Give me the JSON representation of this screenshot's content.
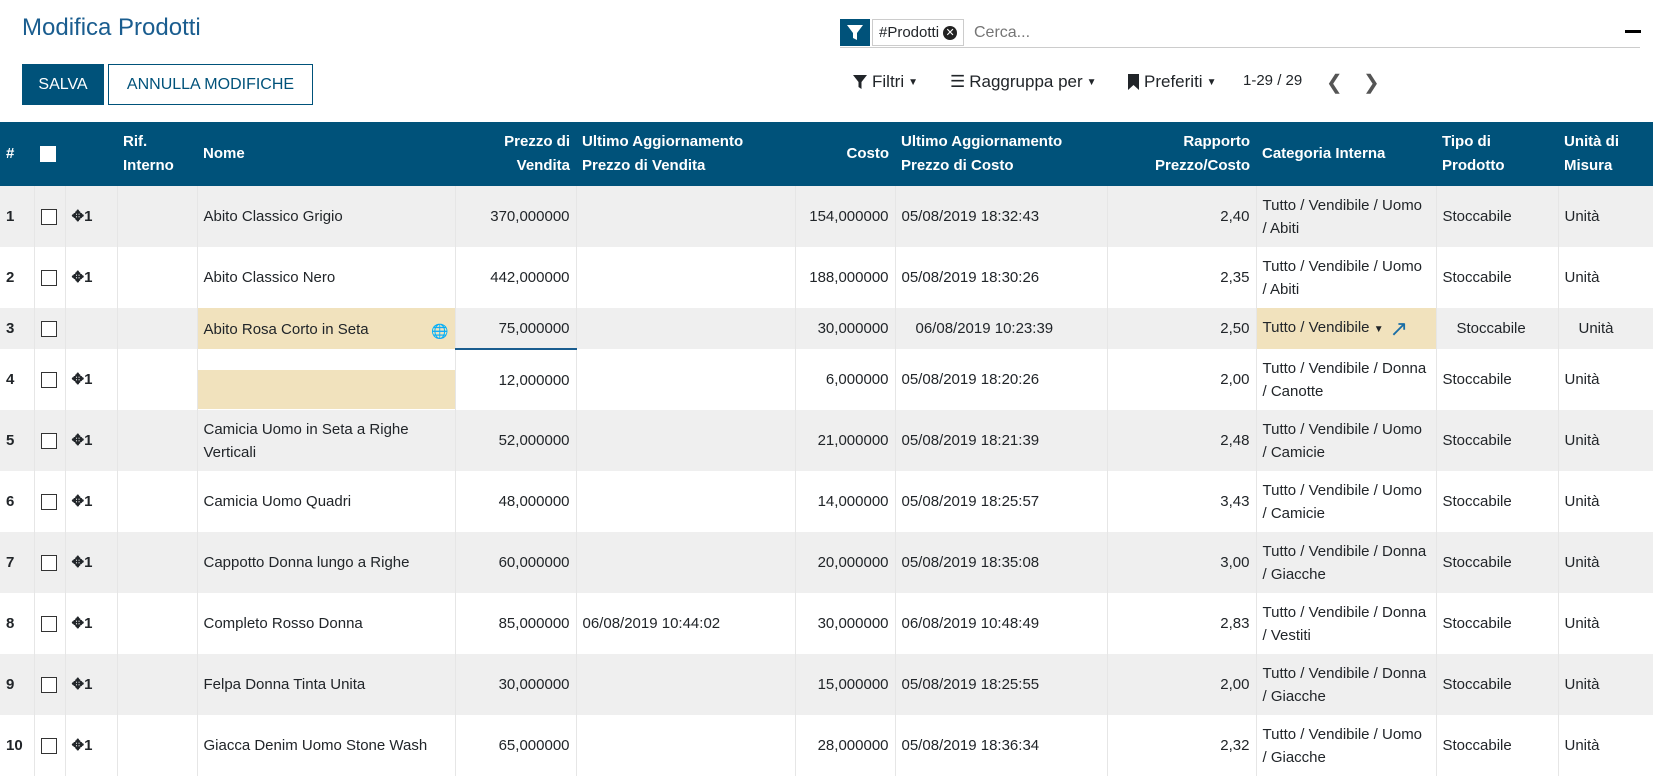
{
  "page": {
    "title": "Modifica Prodotti"
  },
  "buttons": {
    "save": "SALVA",
    "cancel": "ANNULLA MODIFICHE"
  },
  "search": {
    "facet": "#Prodotti",
    "placeholder": "Cerca..."
  },
  "controls": {
    "filters": "Filtri",
    "group_by": "Raggruppa per",
    "favorites": "Preferiti",
    "pager": "1-29 / 29"
  },
  "columns": {
    "num": "#",
    "ref": "Rif. Interno",
    "name": "Nome",
    "sale_price": "Prezzo di Vendita",
    "sale_update": "Ultimo Aggiornamento Prezzo di Vendita",
    "cost": "Costo",
    "cost_update": "Ultimo Aggiornamento Prezzo di Costo",
    "ratio": "Rapporto Prezzo/Costo",
    "category": "Categoria Interna",
    "type": "Tipo di Prodotto",
    "uom": "Unità di Misura"
  },
  "rows": [
    {
      "n": "1",
      "seq": "1",
      "name": "Abito Classico Grigio",
      "price": "370,000000",
      "sale_update": "",
      "cost": "154,000000",
      "cost_update": "05/08/2019 18:32:43",
      "ratio": "2,40",
      "category": "Tutto / Vendibile / Uomo / Abiti",
      "type": "Stoccabile",
      "uom": "Unità"
    },
    {
      "n": "2",
      "seq": "1",
      "name": "Abito Classico Nero",
      "price": "442,000000",
      "sale_update": "",
      "cost": "188,000000",
      "cost_update": "05/08/2019 18:30:26",
      "ratio": "2,35",
      "category": "Tutto / Vendibile / Uomo / Abiti",
      "type": "Stoccabile",
      "uom": "Unità"
    },
    {
      "n": "3",
      "seq": "",
      "name": "Abito Rosa Corto in Seta",
      "price": "75,000000",
      "sale_update": "",
      "cost": "30,000000",
      "cost_update": "06/08/2019 10:23:39",
      "ratio": "2,50",
      "category": "Tutto / Vendibile",
      "type": "Stoccabile",
      "uom": "Unità"
    },
    {
      "n": "4",
      "seq": "1",
      "name": "",
      "price": "12,000000",
      "sale_update": "",
      "cost": "6,000000",
      "cost_update": "05/08/2019 18:20:26",
      "ratio": "2,00",
      "category": "Tutto / Vendibile / Donna / Canotte",
      "type": "Stoccabile",
      "uom": "Unità"
    },
    {
      "n": "5",
      "seq": "1",
      "name": "Camicia Uomo in Seta a Righe Verticali",
      "price": "52,000000",
      "sale_update": "",
      "cost": "21,000000",
      "cost_update": "05/08/2019 18:21:39",
      "ratio": "2,48",
      "category": "Tutto / Vendibile / Uomo / Camicie",
      "type": "Stoccabile",
      "uom": "Unità"
    },
    {
      "n": "6",
      "seq": "1",
      "name": "Camicia Uomo Quadri",
      "price": "48,000000",
      "sale_update": "",
      "cost": "14,000000",
      "cost_update": "05/08/2019 18:25:57",
      "ratio": "3,43",
      "category": "Tutto / Vendibile / Uomo / Camicie",
      "type": "Stoccabile",
      "uom": "Unità"
    },
    {
      "n": "7",
      "seq": "1",
      "name": "Cappotto Donna lungo a Righe",
      "price": "60,000000",
      "sale_update": "",
      "cost": "20,000000",
      "cost_update": "05/08/2019 18:35:08",
      "ratio": "3,00",
      "category": "Tutto / Vendibile / Donna / Giacche",
      "type": "Stoccabile",
      "uom": "Unità"
    },
    {
      "n": "8",
      "seq": "1",
      "name": "Completo Rosso Donna",
      "price": "85,000000",
      "sale_update": "06/08/2019 10:44:02",
      "cost": "30,000000",
      "cost_update": "06/08/2019 10:48:49",
      "ratio": "2,83",
      "category": "Tutto / Vendibile / Donna / Vestiti",
      "type": "Stoccabile",
      "uom": "Unità"
    },
    {
      "n": "9",
      "seq": "1",
      "name": "Felpa Donna Tinta Unita",
      "price": "30,000000",
      "sale_update": "",
      "cost": "15,000000",
      "cost_update": "05/08/2019 18:25:55",
      "ratio": "2,00",
      "category": "Tutto / Vendibile / Donna / Giacche",
      "type": "Stoccabile",
      "uom": "Unità"
    },
    {
      "n": "10",
      "seq": "1",
      "name": "Giacca Denim Uomo Stone Wash",
      "price": "65,000000",
      "sale_update": "",
      "cost": "28,000000",
      "cost_update": "05/08/2019 18:36:34",
      "ratio": "2,32",
      "category": "Tutto / Vendibile / Uomo / Giacche",
      "type": "Stoccabile",
      "uom": "Unità"
    }
  ],
  "colors": {
    "primary": "#00527a",
    "edit_highlight": "#f1e2bd",
    "row_alt": "#efefef"
  }
}
